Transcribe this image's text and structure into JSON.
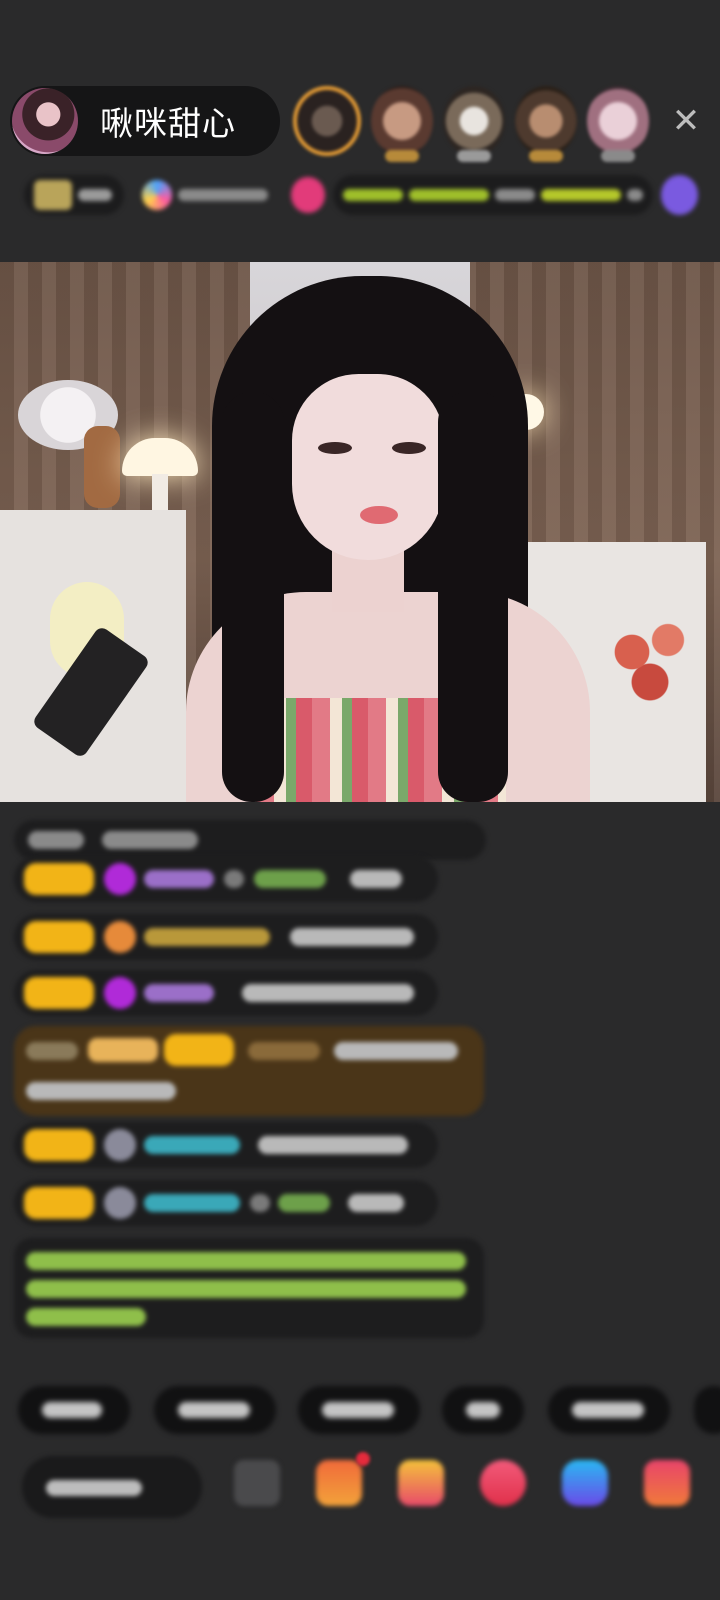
{
  "header": {
    "host_name": "啾咪甜心",
    "close_icon": "close-icon",
    "viewer_count_visible": 5
  },
  "colors": {
    "background": "#2a2a2b",
    "pill": "#151516",
    "badge": "#f2b417",
    "accent_gold": "#e29a35",
    "green_text": "#8fbf4a"
  },
  "chat": {
    "message_count": 8
  },
  "quick_replies": {
    "count": 5
  },
  "bottom_bar": {
    "icons": [
      "emoji-icon",
      "gift-box-icon",
      "bag-icon",
      "heart-icon",
      "controller-icon",
      "more-icon"
    ]
  }
}
